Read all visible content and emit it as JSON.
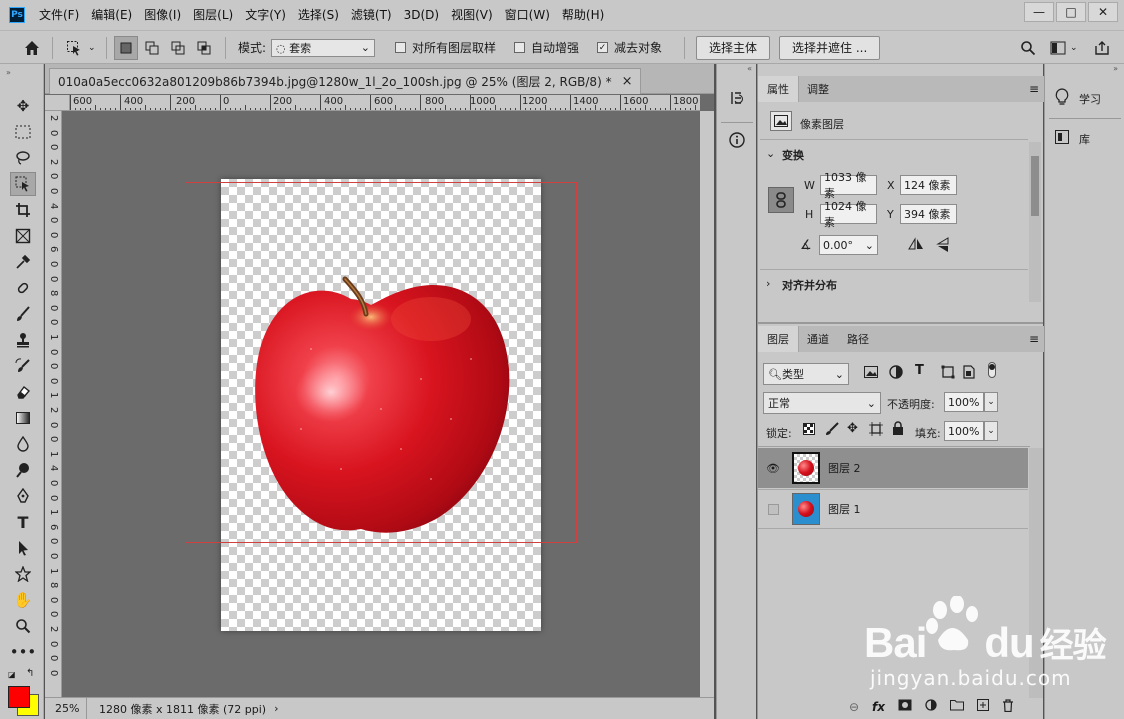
{
  "menubar": {
    "logo": "Ps",
    "items": [
      "文件(F)",
      "编辑(E)",
      "图像(I)",
      "图层(L)",
      "文字(Y)",
      "选择(S)",
      "滤镜(T)",
      "3D(D)",
      "视图(V)",
      "窗口(W)",
      "帮助(H)"
    ],
    "win_min": "—",
    "win_max": "□",
    "win_close": "✕"
  },
  "options": {
    "mode_label": "模式:",
    "mode_value": "套索",
    "sample_all": "对所有图层取样",
    "auto_enhance": "自动增强",
    "subtract": "减去对象",
    "sample_all_checked": false,
    "auto_enhance_checked": false,
    "subtract_checked": true,
    "select_subject": "选择主体",
    "select_mask": "选择并遮住 ..."
  },
  "document": {
    "tab_title": "010a0a5ecc0632a801209b86b7394b.jpg@1280w_1l_2o_100sh.jpg @ 25% (图层 2, RGB/8) *",
    "tab_close": "×",
    "ruler_h": [
      "600",
      "400",
      "200",
      "0",
      "200",
      "400",
      "600",
      "800",
      "1000",
      "1200",
      "1400",
      "1600",
      "1800"
    ],
    "ruler_v": [
      "2",
      "0",
      "0",
      "2",
      "0",
      "0",
      "4",
      "0",
      "0",
      "6",
      "0",
      "0",
      "8",
      "0",
      "0",
      "1",
      "0",
      "0",
      "0",
      "1",
      "2",
      "0",
      "0",
      "1",
      "4",
      "0",
      "0",
      "1",
      "6",
      "0",
      "0",
      "1",
      "8",
      "0",
      "0",
      "2",
      "0",
      "0",
      "0"
    ]
  },
  "status": {
    "zoom": "25%",
    "info": "1280 像素 x 1811 像素 (72 ppi)",
    "arrow": "›"
  },
  "properties": {
    "tabs": [
      "属性",
      "调整"
    ],
    "layer_type": "像素图层",
    "transform_title": "变换",
    "w_label": "W",
    "w_value": "1033 像素",
    "x_label": "X",
    "x_value": "124 像素",
    "h_label": "H",
    "h_value": "1024 像素",
    "y_label": "Y",
    "y_value": "394 像素",
    "angle_value": "0.00°",
    "align_title": "对齐并分布"
  },
  "layers": {
    "tabs": [
      "图层",
      "通道",
      "路径"
    ],
    "filter_value": "类型",
    "blend_mode": "正常",
    "opacity_label": "不透明度:",
    "opacity_value": "100%",
    "lock_label": "锁定:",
    "fill_label": "填充:",
    "fill_value": "100%",
    "rows": [
      {
        "name": "图层 2",
        "visible": true,
        "selected": true
      },
      {
        "name": "图层 1",
        "visible": false,
        "selected": false
      }
    ]
  },
  "learn": {
    "learn_label": "学习",
    "library_label": "库"
  },
  "watermark": {
    "brand": "Bai",
    "brand2": "du",
    "cn": "经验",
    "url": "jingyan.baidu.com"
  },
  "colors": {
    "foreground": "#ff0000",
    "background": "#ffff00",
    "selection": "#d04040"
  }
}
